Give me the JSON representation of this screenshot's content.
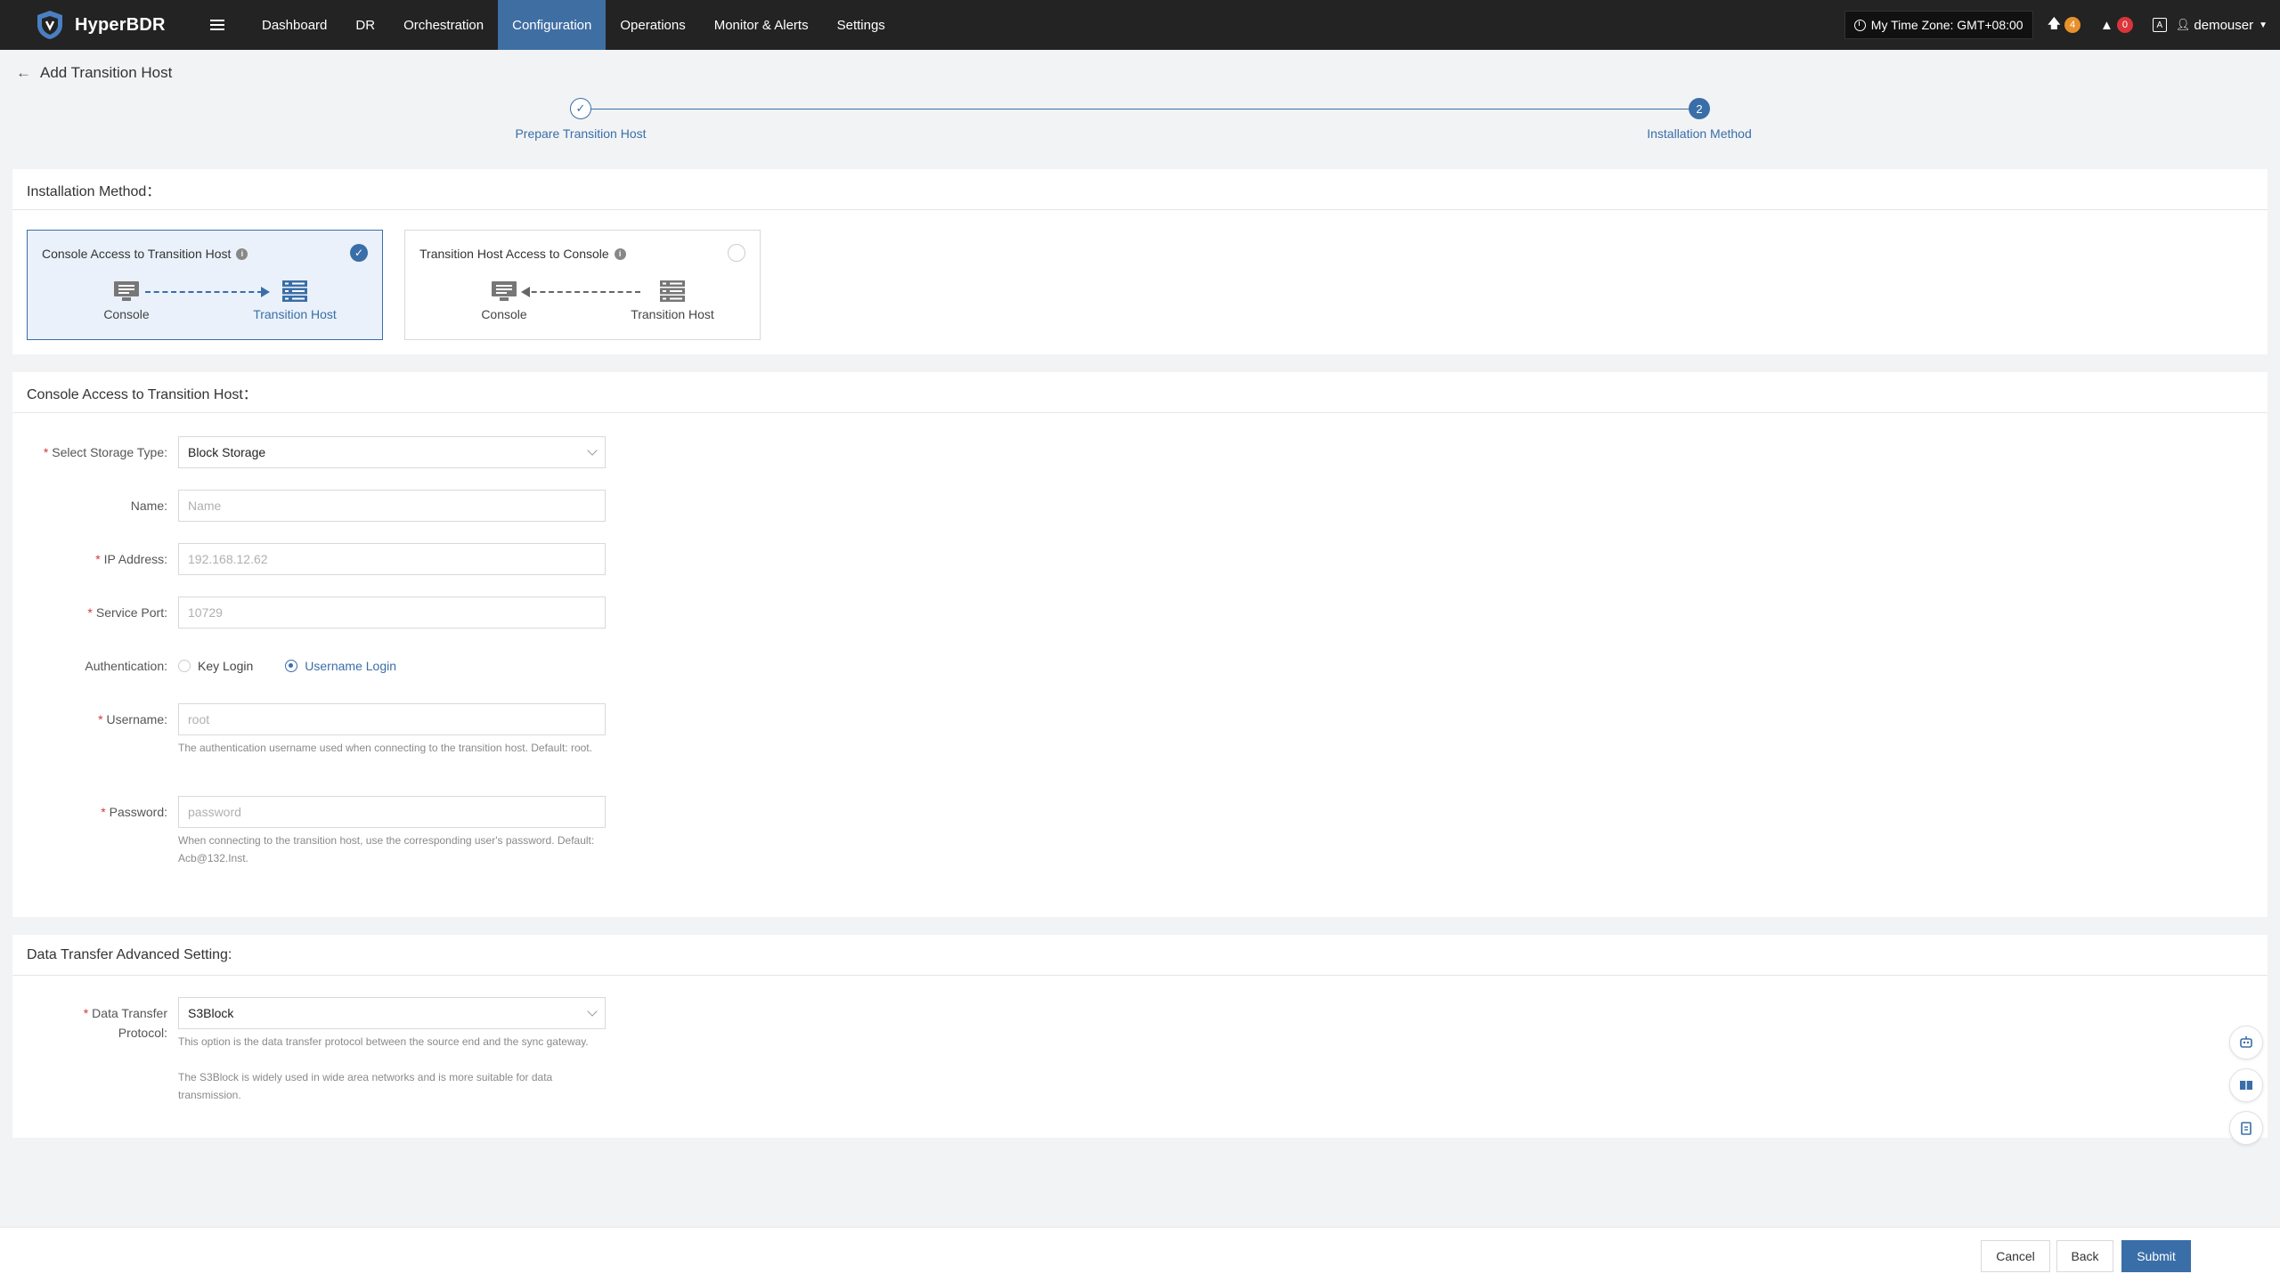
{
  "app": {
    "name": "HyperBDR"
  },
  "nav": {
    "items": [
      {
        "label": "Dashboard"
      },
      {
        "label": "DR"
      },
      {
        "label": "Orchestration"
      },
      {
        "label": "Configuration"
      },
      {
        "label": "Operations"
      },
      {
        "label": "Monitor & Alerts"
      },
      {
        "label": "Settings"
      }
    ],
    "active": "Configuration"
  },
  "topright": {
    "timezone": "My Time Zone: GMT+08:00",
    "upload_count": "4",
    "alert_count": "0",
    "username": "demouser"
  },
  "page": {
    "title": "Add Transition Host"
  },
  "steps": [
    {
      "label": "Prepare Transition Host",
      "state": "done"
    },
    {
      "label": "Installation Method",
      "number": "2",
      "state": "current"
    }
  ],
  "installation": {
    "section_title": "Installation Method：",
    "options": [
      {
        "title": "Console Access to Transition Host",
        "console": "Console",
        "host": "Transition Host",
        "selected": true
      },
      {
        "title": "Transition Host Access to Console",
        "console": "Console",
        "host": "Transition Host",
        "selected": false
      }
    ]
  },
  "form": {
    "section_title": "Console Access to Transition Host：",
    "storage_type": {
      "label": "Select Storage Type:",
      "value": "Block Storage"
    },
    "name": {
      "label": "Name:",
      "placeholder": "Name"
    },
    "ip": {
      "label": "IP Address:",
      "placeholder": "192.168.12.62"
    },
    "port": {
      "label": "Service Port:",
      "placeholder": "10729"
    },
    "auth": {
      "label": "Authentication:",
      "options": [
        "Key Login",
        "Username Login"
      ],
      "selected": "Username Login"
    },
    "username": {
      "label": "Username:",
      "placeholder": "root",
      "hint": "The authentication username used when connecting to the transition host. Default: root."
    },
    "password": {
      "label": "Password:",
      "placeholder": "password",
      "hint": "When connecting to the transition host, use the corresponding user's password. Default: Acb@132.Inst."
    }
  },
  "advanced": {
    "section_title": "Data Transfer Advanced Setting:",
    "protocol": {
      "label_line1": "Data Transfer",
      "label_line2": "Protocol:",
      "value": "S3Block",
      "hint1": "This option is the data transfer protocol between the source end and the sync gateway.",
      "hint2": "The S3Block is widely used in wide area networks and is more suitable for data transmission."
    }
  },
  "footer": {
    "cancel": "Cancel",
    "back": "Back",
    "submit": "Submit"
  },
  "colors": {
    "accent": "#3a6ea8",
    "topbar": "#232323",
    "warning_badge": "#e6912b",
    "alert_badge": "#d9353b"
  },
  "icons": [
    "logo-icon",
    "menu-icon",
    "clock-icon",
    "upload-icon",
    "warning-icon",
    "language-icon",
    "user-icon",
    "back-arrow-icon",
    "check-icon",
    "info-icon",
    "console-icon",
    "server-icon",
    "robot-icon",
    "book-icon",
    "clipboard-icon"
  ]
}
